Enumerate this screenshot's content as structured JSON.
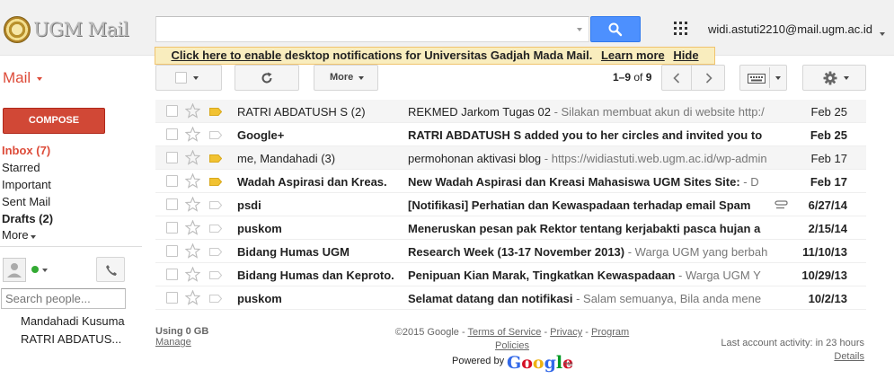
{
  "header": {
    "logo_text": "UGM Mail",
    "search_placeholder": "",
    "account_email": "widi.astuti2210@mail.ugm.ac.id"
  },
  "notification": {
    "link1": "Click here to enable",
    "text": "desktop notifications for Universitas Gadjah Mada Mail.",
    "link2": "Learn more",
    "link3": "Hide"
  },
  "toolbar": {
    "mail_label": "Mail",
    "more_label": "More",
    "pager_range": "1–9",
    "pager_of": "of",
    "pager_total": "9"
  },
  "sidebar": {
    "compose_label": "COMPOSE",
    "items": [
      {
        "label": "Inbox (7)"
      },
      {
        "label": "Starred"
      },
      {
        "label": "Important"
      },
      {
        "label": "Sent Mail"
      },
      {
        "label": "Drafts (2)"
      },
      {
        "label": "More"
      }
    ],
    "search_people_placeholder": "Search people...",
    "contacts": [
      "Mandahadi Kusuma",
      "RATRI ABDATUS..."
    ]
  },
  "emails": [
    {
      "sender": "RATRI ABDATUSH S (2)",
      "subject": "REKMED Jarkom Tugas 02",
      "snippet": " - Silakan membuat akun di website http:/",
      "date": "Feb 25",
      "read": true,
      "important": true,
      "attachment": false
    },
    {
      "sender": "Google+",
      "subject": "RATRI ABDATUSH S added you to her circles and invited you to",
      "snippet": "",
      "date": "Feb 25",
      "read": false,
      "important": false,
      "attachment": false
    },
    {
      "sender": "me, Mandahadi (3)",
      "subject": "permohonan aktivasi blog",
      "snippet": " - https://widiastuti.web.ugm.ac.id/wp-admin",
      "date": "Feb 17",
      "read": true,
      "important": true,
      "attachment": false
    },
    {
      "sender": "Wadah Aspirasi dan Kreas.",
      "subject": "New Wadah Aspirasi dan Kreasi Mahasiswa UGM Sites Site:",
      "snippet": " - D",
      "date": "Feb 17",
      "read": false,
      "important": true,
      "attachment": false
    },
    {
      "sender": "psdi",
      "subject": "[Notifikasi] Perhatian dan Kewaspadaan terhadap email Spam",
      "snippet": "",
      "date": "6/27/14",
      "read": false,
      "important": false,
      "attachment": true
    },
    {
      "sender": "puskom",
      "subject": "Meneruskan pesan pak Rektor tentang kerjabakti pasca hujan a",
      "snippet": "",
      "date": "2/15/14",
      "read": false,
      "important": false,
      "attachment": false
    },
    {
      "sender": "Bidang Humas UGM",
      "subject": "Research Week (13-17 November 2013)",
      "snippet": " - Warga UGM yang berbah",
      "date": "11/10/13",
      "read": false,
      "important": false,
      "attachment": false
    },
    {
      "sender": "Bidang Humas dan Keproto.",
      "subject": "Penipuan Kian Marak, Tingkatkan Kewaspadaan",
      "snippet": " - Warga UGM Y",
      "date": "10/29/13",
      "read": false,
      "important": false,
      "attachment": false
    },
    {
      "sender": "puskom",
      "subject": "Selamat datang dan notifikasi",
      "snippet": " - Salam semuanya, Bila anda mene",
      "date": "10/2/13",
      "read": false,
      "important": false,
      "attachment": false
    }
  ],
  "footer": {
    "usage": "Using 0 GB",
    "manage": "Manage",
    "copyright": "©2015 Google - ",
    "terms": "Terms of Service",
    "sep": " - ",
    "privacy": "Privacy",
    "program": "Program",
    "policies": "Policies",
    "powered_by": "Powered by",
    "google": "Google",
    "tm": "TM",
    "last_activity": "Last account activity: in 23 hours",
    "details": "Details"
  },
  "colors": {
    "accent_red": "#dd4b39",
    "compose_bg": "#d14836",
    "search_blue": "#4d90fe",
    "important_yellow": "#f1c232"
  }
}
